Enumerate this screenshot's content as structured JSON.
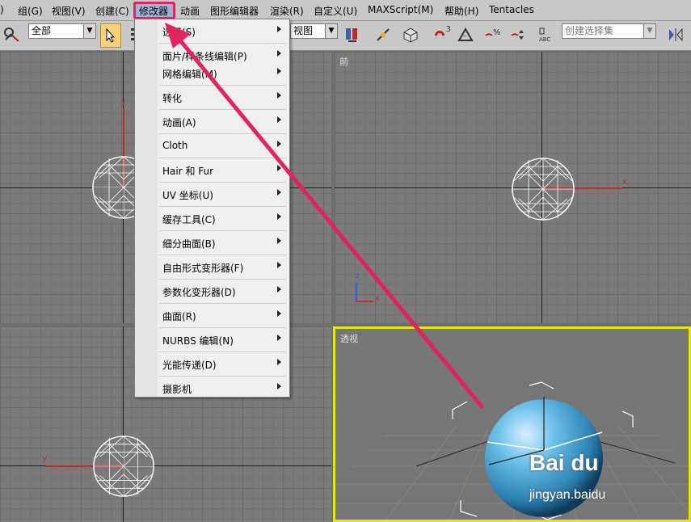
{
  "menubar": {
    "items": [
      ")",
      "组(G)",
      "视图(V)",
      "创建(C)",
      "修改器",
      "动画",
      "图形编辑器",
      "渲染(R)",
      "自定义(U)",
      "MAXScript(M)",
      "帮助(H)",
      "Tentacles"
    ],
    "active_index": 4
  },
  "toolbar": {
    "selection_filter": "全部",
    "view_label": "视图",
    "named_selection_placeholder": "创建选择集",
    "snap_label": "3"
  },
  "viewports": {
    "top_left": {
      "label": ""
    },
    "front": {
      "label": "前"
    },
    "left": {
      "label": ""
    },
    "perspective": {
      "label": "透视"
    }
  },
  "dropdown": {
    "items": [
      {
        "label": "选择(S)",
        "submenu": true
      },
      {
        "label": "面片/样条线编辑(P)",
        "submenu": true
      },
      {
        "label": "网格编辑(M)",
        "submenu": true
      },
      {
        "label": "转化",
        "submenu": true
      },
      {
        "label": "动画(A)",
        "submenu": true
      },
      {
        "label": "Cloth",
        "submenu": true
      },
      {
        "label": "Hair 和 Fur",
        "submenu": true
      },
      {
        "label": "UV 坐标(U)",
        "submenu": true
      },
      {
        "label": "缓存工具(C)",
        "submenu": true
      },
      {
        "label": "细分曲面(B)",
        "submenu": true
      },
      {
        "label": "自由形式变形器(F)",
        "submenu": true
      },
      {
        "label": "参数化变形器(D)",
        "submenu": true
      },
      {
        "label": "曲面(R)",
        "submenu": true
      },
      {
        "label": "NURBS 编辑(N)",
        "submenu": true
      },
      {
        "label": "光能传递(D)",
        "submenu": true
      },
      {
        "label": "摄影机",
        "submenu": true
      }
    ]
  },
  "axes": {
    "x": "x",
    "y": "y",
    "z": "z"
  },
  "watermark": {
    "brand": "Bai du",
    "url": "jingyan.baidu"
  },
  "colors": {
    "highlight": "#e0245e",
    "active_viewport": "#e8e21a",
    "sphere": "#4fa8d8",
    "menu_bg": "#c8c8c8"
  }
}
